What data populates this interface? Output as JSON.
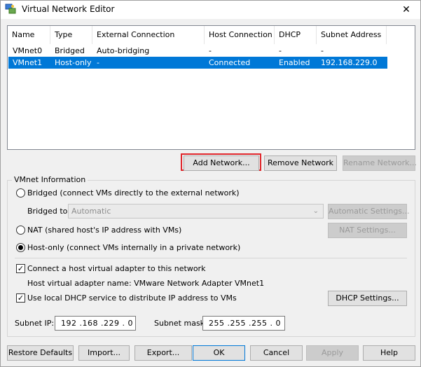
{
  "window": {
    "title": "Virtual Network Editor",
    "close_glyph": "✕",
    "icon": "network-editor-icon"
  },
  "table": {
    "headers": [
      "Name",
      "Type",
      "External Connection",
      "Host Connection",
      "DHCP",
      "Subnet Address"
    ],
    "rows": [
      [
        "VMnet0",
        "Bridged",
        "Auto-bridging",
        "-",
        "-",
        "-"
      ],
      [
        "VMnet1",
        "Host-only",
        "-",
        "Connected",
        "Enabled",
        "192.168.229.0"
      ]
    ],
    "selected_row": 1
  },
  "network_buttons": {
    "add": "Add Network...",
    "remove": "Remove Network",
    "rename": "Rename Network..."
  },
  "vmnet_info": {
    "group_label": "VMnet Information",
    "bridged_label": "Bridged (connect VMs directly to the external network)",
    "bridged_to_label": "Bridged to:",
    "bridged_to_value": "Automatic",
    "automatic_settings": "Automatic Settings...",
    "nat_label": "NAT (shared host's IP address with VMs)",
    "nat_settings": "NAT Settings...",
    "hostonly_label": "Host-only (connect VMs internally in a private network)",
    "connect_adapter_label": "Connect a host virtual adapter to this network",
    "adapter_name_label": "Host virtual adapter name: VMware Network Adapter VMnet1",
    "dhcp_label": "Use local DHCP service to distribute IP address to VMs",
    "dhcp_settings": "DHCP Settings...",
    "subnet_ip_label": "Subnet IP:",
    "subnet_ip": "192 .168 .229 .  0",
    "subnet_mask_label": "Subnet mask:",
    "subnet_mask": "255 .255 .255 .  0",
    "checkmark": "✓",
    "dropdown_arrow": "⌄"
  },
  "footer": {
    "restore": "Restore Defaults",
    "import": "Import...",
    "export": "Export...",
    "ok": "OK",
    "cancel": "Cancel",
    "apply": "Apply",
    "help": "Help"
  },
  "colors": {
    "selection": "#0078d7",
    "highlight_frame": "#e0262b"
  }
}
